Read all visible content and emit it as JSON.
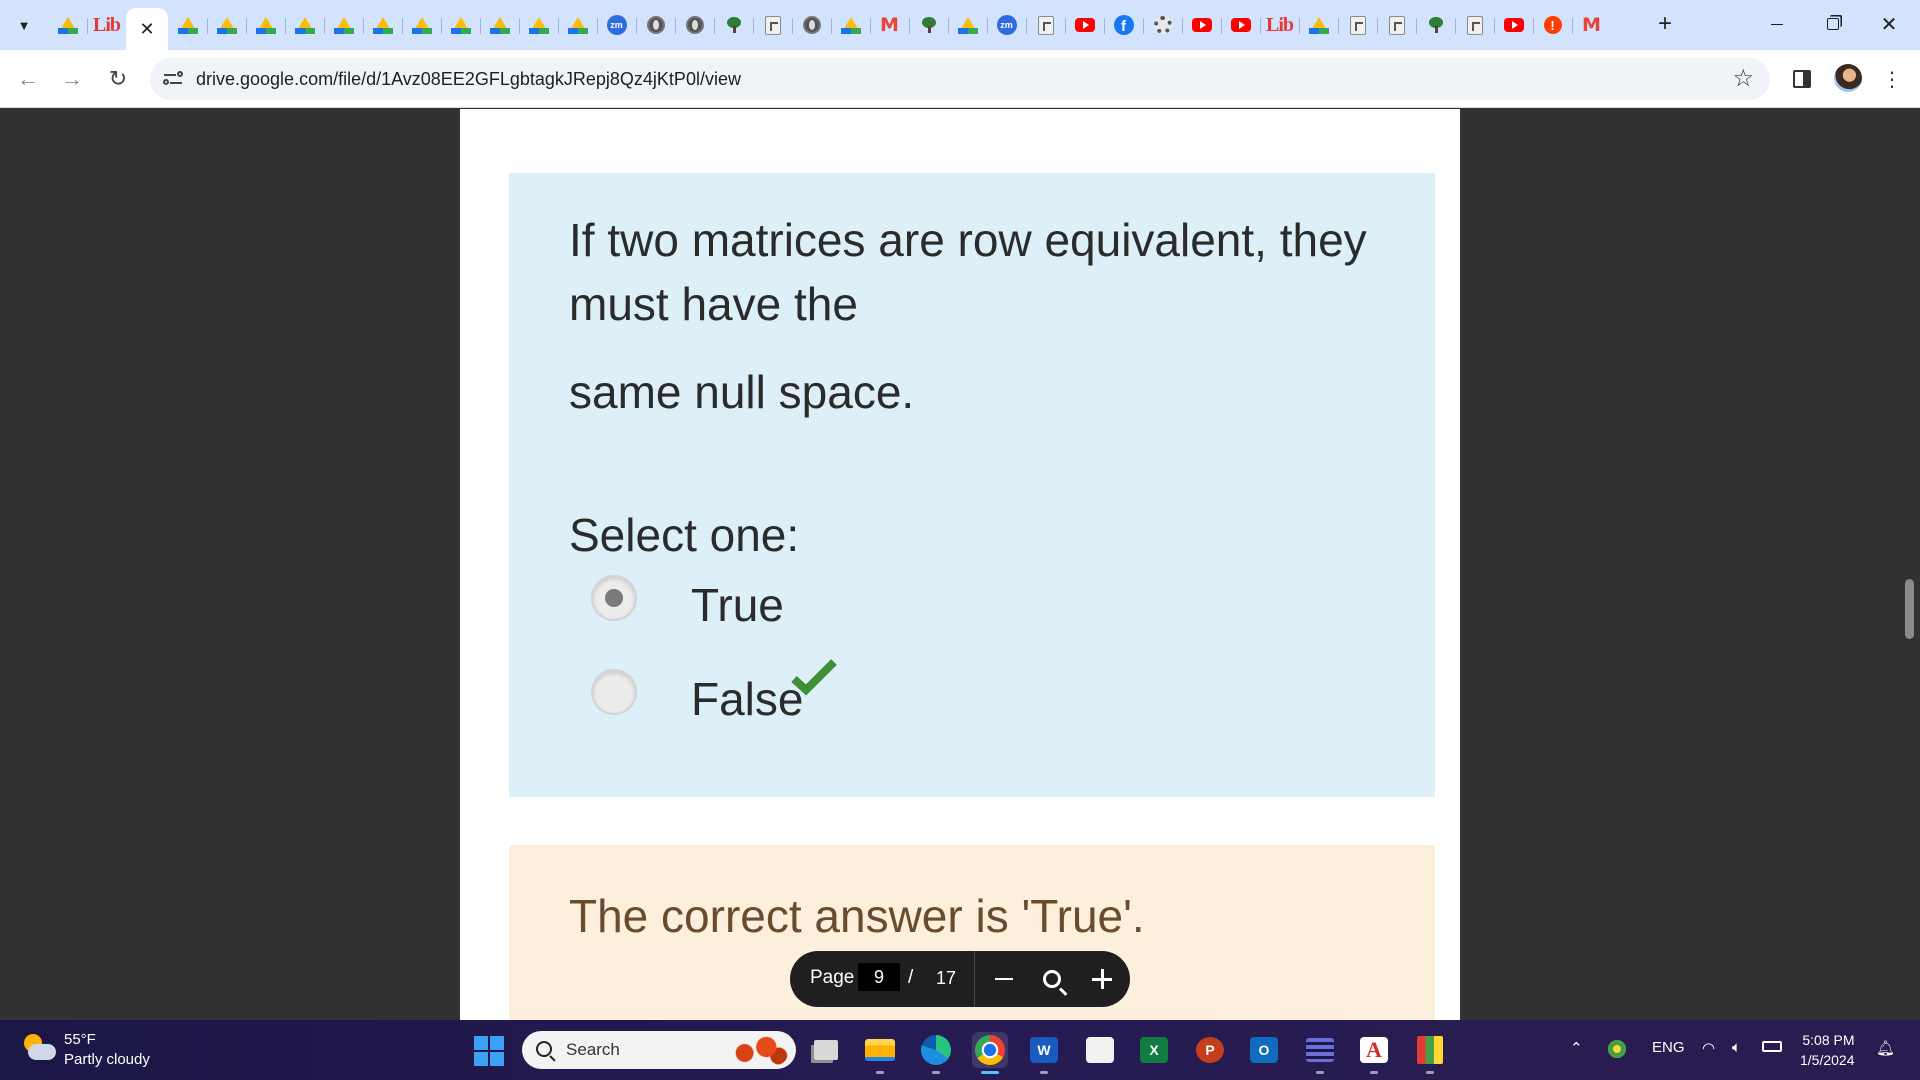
{
  "browser": {
    "tabs": [
      {
        "icon": "drive-icon"
      },
      {
        "icon": "lib-icon",
        "text": "Lib"
      },
      {
        "icon": "close-icon",
        "active": true
      },
      {
        "icon": "drive-icon"
      },
      {
        "icon": "drive-icon"
      },
      {
        "icon": "drive-icon"
      },
      {
        "icon": "drive-icon"
      },
      {
        "icon": "drive-icon"
      },
      {
        "icon": "drive-icon"
      },
      {
        "icon": "drive-icon"
      },
      {
        "icon": "drive-icon"
      },
      {
        "icon": "drive-icon"
      },
      {
        "icon": "drive-icon"
      },
      {
        "icon": "drive-icon"
      },
      {
        "icon": "zoom-icon",
        "text": "zm"
      },
      {
        "icon": "globe-icon"
      },
      {
        "icon": "globe-icon"
      },
      {
        "icon": "tree-icon"
      },
      {
        "icon": "document-icon"
      },
      {
        "icon": "globe-icon"
      },
      {
        "icon": "drive-icon"
      },
      {
        "icon": "gmail-icon",
        "text": "M"
      },
      {
        "icon": "tree-icon"
      },
      {
        "icon": "drive-icon"
      },
      {
        "icon": "zoom-icon",
        "text": "zm"
      },
      {
        "icon": "document-icon"
      },
      {
        "icon": "youtube-icon"
      },
      {
        "icon": "facebook-icon",
        "text": "f"
      },
      {
        "icon": "gear-icon"
      },
      {
        "icon": "youtube-icon"
      },
      {
        "icon": "youtube-icon"
      },
      {
        "icon": "lib-icon",
        "text": "Lib"
      },
      {
        "icon": "drive-icon"
      },
      {
        "icon": "document-icon"
      },
      {
        "icon": "document-icon"
      },
      {
        "icon": "tree-icon"
      },
      {
        "icon": "document-icon"
      },
      {
        "icon": "youtube-icon"
      },
      {
        "icon": "error-icon",
        "text": "!"
      },
      {
        "icon": "gmail-icon",
        "text": "M"
      }
    ],
    "new_tab_label": "+",
    "url": "drive.google.com/file/d/1Avz08EE2GFLgbtagkJRepj8Qz4jKtP0l/view"
  },
  "question": {
    "lines": [
      "If two matrices are row equivalent, they",
      "must have the",
      "same null space."
    ],
    "prompt": "Select one:",
    "options": [
      {
        "label": "True",
        "selected": true,
        "correct": true
      },
      {
        "label": "False",
        "selected": false
      }
    ],
    "feedback": "The correct answer is 'True'."
  },
  "pager": {
    "label": "Page",
    "current": "9",
    "separator": "/",
    "total": "17"
  },
  "taskbar": {
    "weather": {
      "temp": "55°F",
      "desc": "Partly cloudy"
    },
    "search_placeholder": "Search",
    "language": "ENG",
    "time": "5:08 PM",
    "date": "1/5/2024",
    "apps": [
      "task-view",
      "file-explorer",
      "edge",
      "chrome",
      "word",
      "store",
      "excel",
      "powerpoint",
      "outlook",
      "media-app",
      "acrobat",
      "colors-app"
    ]
  },
  "colors": {
    "question_bg": "#ddeff7",
    "feedback_bg": "#fcefdc",
    "check_green": "#3f8f36",
    "tabstrip_bg": "#d3e3fd"
  }
}
